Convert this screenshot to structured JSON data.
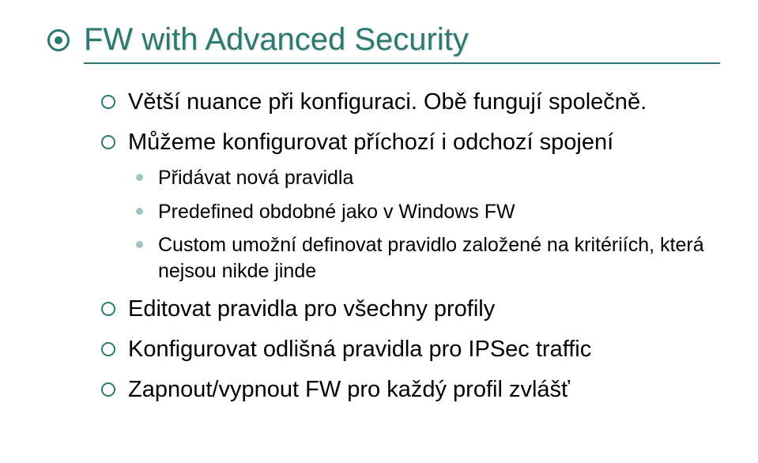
{
  "slide": {
    "title": "FW with Advanced Security",
    "bullets": [
      {
        "text": "Větší nuance při konfiguraci. Obě fungují společně."
      },
      {
        "text": "Můžeme konfigurovat příchozí i odchozí spojení",
        "sub": [
          "Přidávat nová pravidla",
          "Predefined obdobné jako v Windows FW",
          "Custom umožní definovat pravidlo založené na kritériích, která nejsou nikde jinde"
        ]
      },
      {
        "text": "Editovat pravidla pro všechny profily"
      },
      {
        "text": "Konfigurovat odlišná pravidla pro IPSec traffic"
      },
      {
        "text": "Zapnout/vypnout FW pro každý profil zvlášť"
      }
    ]
  }
}
